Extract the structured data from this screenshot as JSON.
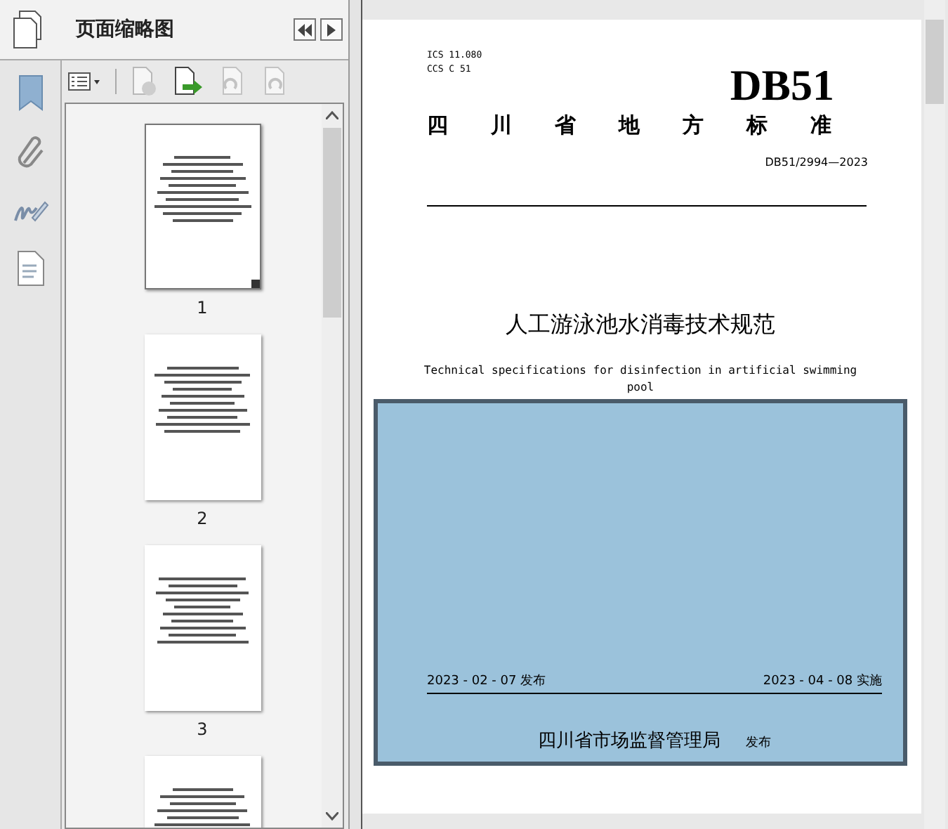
{
  "panel": {
    "title": "页面缩略图"
  },
  "thumbnails": [
    {
      "page": "1",
      "selected": true
    },
    {
      "page": "2",
      "selected": false
    },
    {
      "page": "3",
      "selected": false
    },
    {
      "selected": false
    }
  ],
  "document": {
    "ics": "ICS  11.080",
    "ccs": "CCS  C 51",
    "code": "DB51",
    "category": "四川省地方标准",
    "number": "DB51/2994—2023",
    "title": "人工游泳池水消毒技术规范",
    "english_title": "Technical specifications for disinfection in artificial swimming pool",
    "issue_date": "2023 - 02 - 07 发布",
    "effective_date": "2023 - 04 - 08 实施",
    "publisher": "四川省市场监督管理局",
    "publisher_suffix": "发布"
  }
}
